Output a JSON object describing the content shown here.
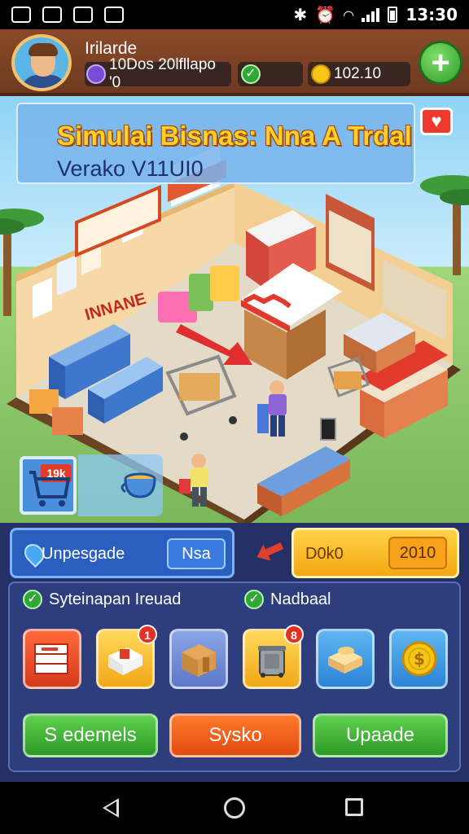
{
  "status_bar": {
    "time": "13:30"
  },
  "header": {
    "player_name": "Irilarde",
    "gems_text": "10Dos 20lfllapo '0",
    "coins": "102.10"
  },
  "scene": {
    "title": "Simulai Bisnas: Nna A Trdal",
    "version": "Verako V11UI0",
    "shop_sign": "INNANE",
    "inventory_tag": "19k"
  },
  "actions": {
    "upgrade_label": "Unpesgade",
    "upgrade_button": "Nsa",
    "cash_label": "D0k0",
    "cash_value": "2010"
  },
  "tasks": {
    "task1": "Syteinapan Ireuad",
    "task2": "Nadbaal"
  },
  "tiles": [
    {
      "name": "brochure",
      "badge": ""
    },
    {
      "name": "delivery-box",
      "badge": "1"
    },
    {
      "name": "cardboard-box",
      "badge": ""
    },
    {
      "name": "trash-bin",
      "badge": "8"
    },
    {
      "name": "bread-crate",
      "badge": ""
    },
    {
      "name": "gold-coin",
      "badge": ""
    }
  ],
  "buttons": {
    "left": "S edemels",
    "middle": "Sysko",
    "right": "Upaade"
  },
  "colors": {
    "header": "#7a4124",
    "panel": "#243066",
    "gold": "#ffcf2a",
    "green": "#2f9b2a",
    "orange": "#e14b10"
  }
}
